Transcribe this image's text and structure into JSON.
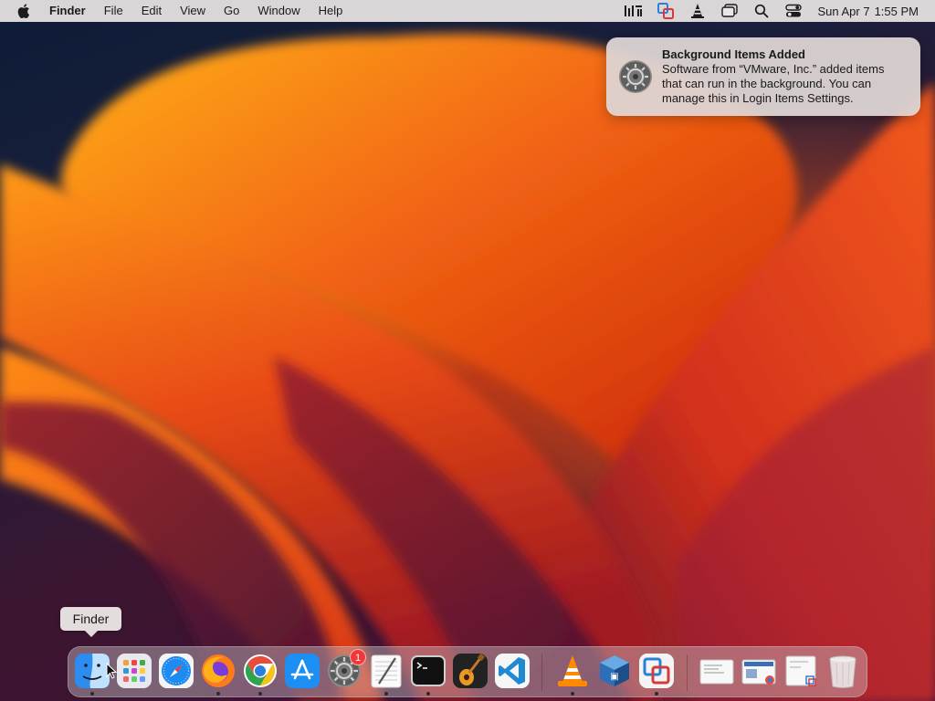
{
  "menubar": {
    "app_name": "Finder",
    "menus": [
      "File",
      "Edit",
      "View",
      "Go",
      "Window",
      "Help"
    ],
    "status_icons": [
      "audio-bars-icon",
      "vmware-icon",
      "vlc-icon",
      "window-stack-icon",
      "search-icon",
      "control-center-icon"
    ],
    "date": "Sun Apr 7",
    "time": "1:55 PM"
  },
  "notification": {
    "icon": "system-settings-icon",
    "title": "Background Items Added",
    "body_lines": [
      "Software from “VMware, Inc.” added items",
      "that can run in the background. You can",
      "manage this in Login Items Settings."
    ]
  },
  "tooltip": {
    "label": "Finder"
  },
  "dock": {
    "settings_badge": "1",
    "apps": [
      {
        "name": "finder",
        "running": true
      },
      {
        "name": "launchpad",
        "running": false
      },
      {
        "name": "safari",
        "running": false
      },
      {
        "name": "firefox",
        "running": true
      },
      {
        "name": "chrome",
        "running": true
      },
      {
        "name": "app-store",
        "running": false
      },
      {
        "name": "system-settings",
        "running": false
      },
      {
        "name": "textedit",
        "running": true
      },
      {
        "name": "terminal",
        "running": true
      },
      {
        "name": "garageband",
        "running": false
      },
      {
        "name": "vscode",
        "running": false
      },
      {
        "name": "vlc",
        "running": true
      },
      {
        "name": "virtualbox",
        "running": false
      },
      {
        "name": "vmware-fusion",
        "running": true
      },
      {
        "name": "recent-document-1",
        "running": false
      },
      {
        "name": "recent-document-2",
        "running": false
      },
      {
        "name": "recent-document-3",
        "running": false
      },
      {
        "name": "trash",
        "running": false
      }
    ]
  }
}
